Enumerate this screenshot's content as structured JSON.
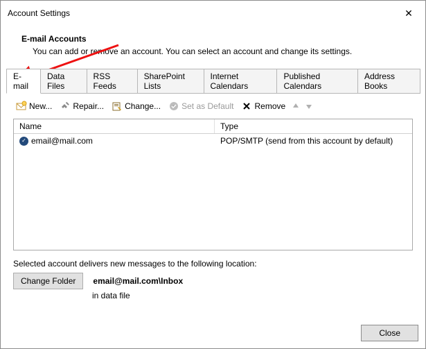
{
  "window": {
    "title": "Account Settings"
  },
  "header": {
    "heading": "E-mail Accounts",
    "subtext": "You can add or remove an account. You can select an account and change its settings."
  },
  "tabs": [
    "E-mail",
    "Data Files",
    "RSS Feeds",
    "SharePoint Lists",
    "Internet Calendars",
    "Published Calendars",
    "Address Books"
  ],
  "toolbar": {
    "new": "New...",
    "repair": "Repair...",
    "change": "Change...",
    "setdefault": "Set as Default",
    "remove": "Remove"
  },
  "columns": {
    "name": "Name",
    "type": "Type"
  },
  "rows": [
    {
      "name": "email@mail.com",
      "type": "POP/SMTP (send from this account by default)"
    }
  ],
  "footer": {
    "line1": "Selected account delivers new messages to the following location:",
    "changefolder": "Change Folder",
    "path_bold": "email@mail.com\\Inbox",
    "path_sub": "in data file"
  },
  "close": "Close"
}
